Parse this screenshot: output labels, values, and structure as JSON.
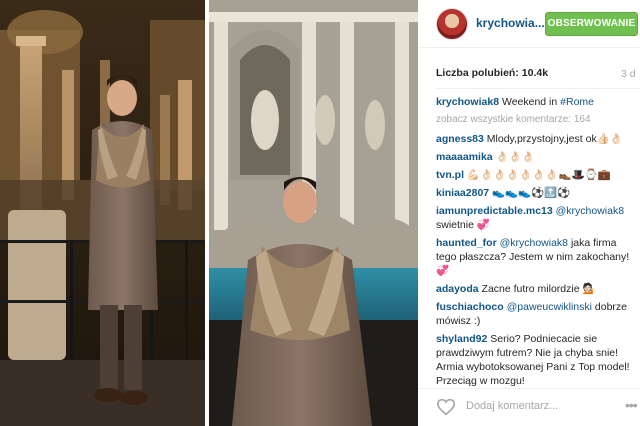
{
  "post": {
    "username": "krychowia...",
    "follow_label": "OBSERWOWANIE",
    "likes_label": "Liczba polubień:",
    "likes_count": "10.4k",
    "time_ago": "3 d",
    "comment_placeholder": "Dodaj komentarz..."
  },
  "caption": {
    "user": "krychowiak8",
    "text": "Weekend in",
    "hashtag": "#Rome"
  },
  "view_all_comments": "zobacz wszystkie komentarze: 164",
  "comments": [
    {
      "user": "agness83",
      "text": "Mlody,przystojny,jest ok👍🏻👌🏻"
    },
    {
      "user": "maaaamika",
      "text": "👌🏻👌🏻👌🏻"
    },
    {
      "user": "tvn.pl",
      "text": "💪🏻👌🏻👌🏻👌🏻👌🏻👌🏻👌🏻👞🎩⌚💼"
    },
    {
      "user": "kiniaa2807",
      "text": "👟👟👟⚽🔝⚽"
    },
    {
      "user": "iamunpredictable.mc13",
      "mention": "@krychowiak8",
      "text": "swietnie 💞"
    },
    {
      "user": "haunted_for",
      "mention": "@krychowiak8",
      "text": "jaka firma tego płaszcza? Jestem w nim zakochany! 💞"
    },
    {
      "user": "adayoda",
      "text": "Zacne futro milordzie 💁🏻"
    },
    {
      "user": "fuschiachoco",
      "mention": "@paweucwiklinski",
      "text": "dobrze mówisz :)"
    },
    {
      "user": "shyland92",
      "text": "Serio? Podniecacie sie prawdziwym futrem? Nie ja chyba snie! Armia wybotoksowanej Pani z Top model! Przeciąg w mozgu!"
    }
  ],
  "icons": {
    "heart": "heart-outline-icon",
    "more": "more-options-icon"
  },
  "colors": {
    "username_blue": "#125688",
    "follow_green": "#70c050",
    "muted_gray": "#a5a7aa"
  }
}
